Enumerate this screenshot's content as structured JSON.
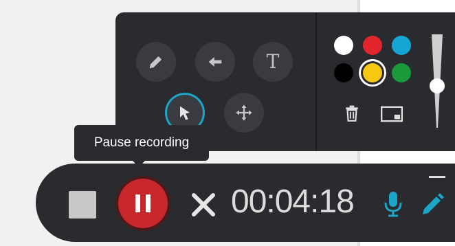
{
  "tooltip": {
    "text": "Pause recording"
  },
  "tools": [
    {
      "name": "pen-tool",
      "icon": "pencil-icon"
    },
    {
      "name": "arrow-tool",
      "icon": "arrow-left-icon"
    },
    {
      "name": "text-tool",
      "icon": "text-icon",
      "glyph": "T"
    },
    {
      "name": "select-tool",
      "icon": "cursor-icon",
      "active": true
    },
    {
      "name": "move-tool",
      "icon": "move-icon"
    }
  ],
  "colors": [
    {
      "name": "white",
      "hex": "#ffffff"
    },
    {
      "name": "red",
      "hex": "#e3262b"
    },
    {
      "name": "blue",
      "hex": "#16a6d6"
    },
    {
      "name": "black",
      "hex": "#000000"
    },
    {
      "name": "yellow",
      "hex": "#f7c812",
      "selected": true
    },
    {
      "name": "green",
      "hex": "#1a9a3a"
    }
  ],
  "panel_actions": [
    {
      "name": "delete-button",
      "icon": "trash-icon"
    },
    {
      "name": "screen-button",
      "icon": "screen-icon"
    }
  ],
  "recorder": {
    "timer": "00:04:18",
    "accent": "#1ba5c8",
    "record_red": "#c8282b"
  }
}
